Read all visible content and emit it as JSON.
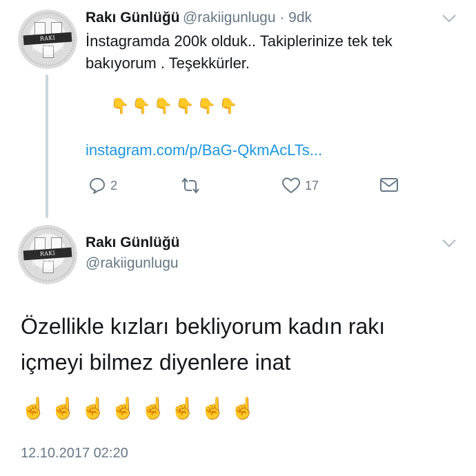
{
  "tweet1": {
    "author_name": "Rakı Günlüğü",
    "author_handle": "@rakiigunlugu",
    "time": " · 9dk",
    "text": "İnstagramda 200k olduk.. Takiplerinize tek tek bakıyorum . Teşekkürler.",
    "emojis": [
      "👇",
      "👇",
      "👇",
      "👇",
      "👇",
      "👇"
    ],
    "link": "instagram.com/p/BaG-QkmAcLTs...",
    "reply_count": "2",
    "like_count": "17"
  },
  "avatar_text": "RAKI GÜNLÜĞÜ",
  "tweet2": {
    "author_name": "Rakı Günlüğü",
    "author_handle": "@rakiigunlugu",
    "text": "Özellikle kızları bekliyorum kadın rakı içmeyi bilmez diyenlere inat",
    "emojis": [
      "☝️",
      "☝️",
      "☝️",
      "☝️",
      "☝️",
      "☝️",
      "☝️",
      "☝️"
    ],
    "timestamp": "12.10.2017 02:20"
  },
  "colors": {
    "link": "#1b95e0",
    "muted": "#657786",
    "thread_line": "#ccd6dd"
  },
  "icons": [
    "reply-icon",
    "retweet-icon",
    "like-icon",
    "message-icon",
    "chevron-down-icon"
  ]
}
